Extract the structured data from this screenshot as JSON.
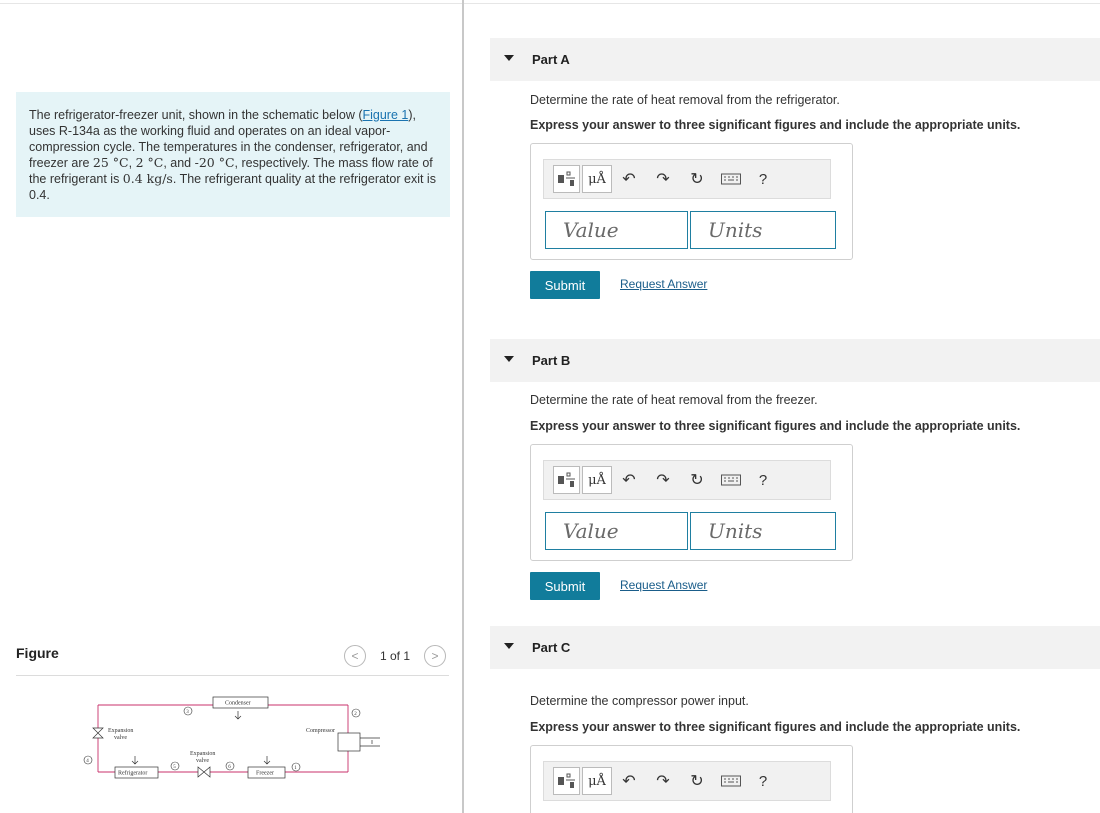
{
  "problem": {
    "pre_link": "The refrigerator-freezer unit, shown in the schematic below (",
    "link": "Figure 1",
    "post_link": "), uses R-134a as the working fluid and operates on an ideal vapor-compression cycle. The temperatures in the condenser, refrigerator, and freezer are ",
    "t_cond": "25 °C",
    "sep1": ", ",
    "t_ref": "2 °C",
    "sep2": ", and ",
    "t_frz": "-20 °C",
    "post_temps": ", respectively. The mass flow rate of the refrigerant is ",
    "mass_flow": "0.4 kg/s",
    "post_mass": ". The refrigerant quality at the refrigerator exit is 0.4."
  },
  "figure": {
    "title": "Figure",
    "prev": "<",
    "next": ">",
    "count": "1 of 1",
    "labels": {
      "condenser": "Condenser",
      "compressor": "Compressor",
      "expansion_valve_1": "Expansion",
      "expansion_valve_1b": "valve",
      "expansion_valve_2": "Expansion",
      "expansion_valve_2b": "valve",
      "refrigerator": "Refrigerator",
      "freezer": "Freezer",
      "s1": "1",
      "s2": "2",
      "s3": "3",
      "s4": "4",
      "s5": "5",
      "s6": "6"
    }
  },
  "toolbar": {
    "units_btn": "μÅ",
    "help": "?"
  },
  "parts": [
    {
      "label": "Part A",
      "question": "Determine the rate of heat removal from the refrigerator.",
      "instruction": "Express your answer to three significant figures and include the appropriate units.",
      "value_placeholder": "Value",
      "units_placeholder": "Units",
      "submit": "Submit",
      "request": "Request Answer"
    },
    {
      "label": "Part B",
      "question": "Determine the rate of heat removal from the freezer.",
      "instruction": "Express your answer to three significant figures and include the appropriate units.",
      "value_placeholder": "Value",
      "units_placeholder": "Units",
      "submit": "Submit",
      "request": "Request Answer"
    },
    {
      "label": "Part C",
      "question": "Determine the compressor power input.",
      "instruction": "Express your answer to three significant figures and include the appropriate units."
    }
  ]
}
